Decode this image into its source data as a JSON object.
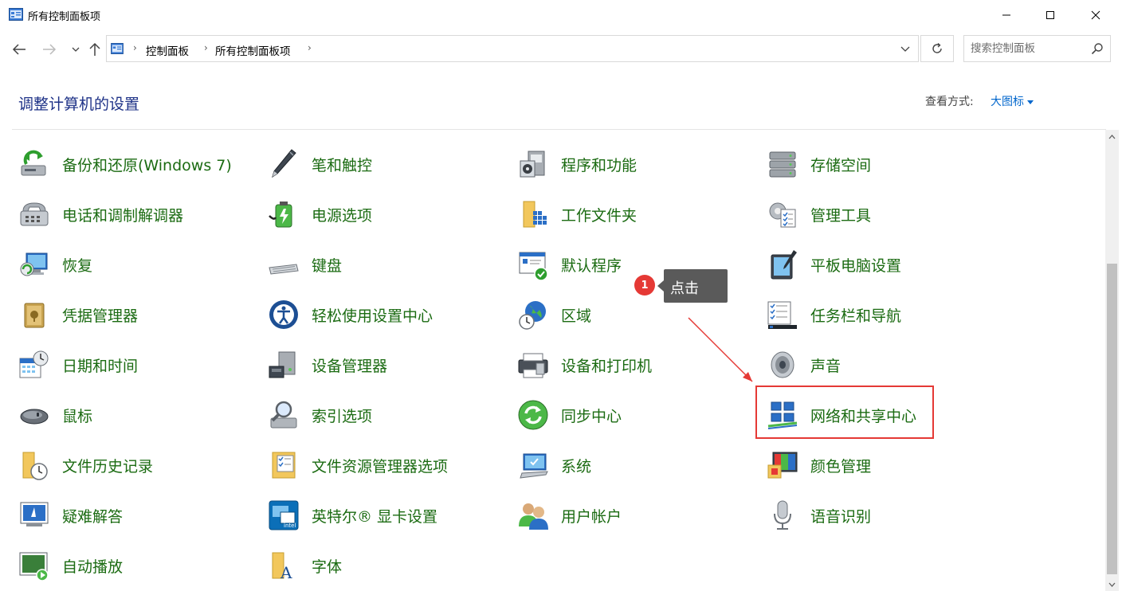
{
  "window": {
    "title": "所有控制面板项",
    "icon": "control-panel-icon"
  },
  "nav": {
    "back": "back-arrow-icon",
    "forward": "forward-arrow-icon",
    "recent": "chevron-down-icon",
    "up": "up-arrow-icon"
  },
  "address": {
    "crumbs": [
      "控制面板",
      "所有控制面板项"
    ],
    "separator": "›"
  },
  "search": {
    "placeholder": "搜索控制面板"
  },
  "header": {
    "title": "调整计算机的设置",
    "view_label": "查看方式:",
    "view_value": "大图标"
  },
  "items": [
    {
      "label": "备份和还原(Windows 7)",
      "icon": "backup-restore-icon"
    },
    {
      "label": "笔和触控",
      "icon": "pen-icon"
    },
    {
      "label": "程序和功能",
      "icon": "programs-icon"
    },
    {
      "label": "存储空间",
      "icon": "storage-icon"
    },
    {
      "label": "电话和调制解调器",
      "icon": "phone-modem-icon"
    },
    {
      "label": "电源选项",
      "icon": "power-icon"
    },
    {
      "label": "工作文件夹",
      "icon": "work-folders-icon"
    },
    {
      "label": "管理工具",
      "icon": "admin-tools-icon"
    },
    {
      "label": "恢复",
      "icon": "recovery-icon"
    },
    {
      "label": "键盘",
      "icon": "keyboard-icon"
    },
    {
      "label": "默认程序",
      "icon": "default-programs-icon"
    },
    {
      "label": "平板电脑设置",
      "icon": "tablet-icon"
    },
    {
      "label": "凭据管理器",
      "icon": "credential-icon"
    },
    {
      "label": "轻松使用设置中心",
      "icon": "ease-of-access-icon"
    },
    {
      "label": "区域",
      "icon": "region-icon"
    },
    {
      "label": "任务栏和导航",
      "icon": "taskbar-icon"
    },
    {
      "label": "日期和时间",
      "icon": "datetime-icon"
    },
    {
      "label": "设备管理器",
      "icon": "device-manager-icon"
    },
    {
      "label": "设备和打印机",
      "icon": "printer-icon"
    },
    {
      "label": "声音",
      "icon": "sound-icon"
    },
    {
      "label": "鼠标",
      "icon": "mouse-icon"
    },
    {
      "label": "索引选项",
      "icon": "indexing-icon"
    },
    {
      "label": "同步中心",
      "icon": "sync-icon"
    },
    {
      "label": "网络和共享中心",
      "icon": "network-icon"
    },
    {
      "label": "文件历史记录",
      "icon": "file-history-icon"
    },
    {
      "label": "文件资源管理器选项",
      "icon": "folder-options-icon"
    },
    {
      "label": "系统",
      "icon": "system-icon"
    },
    {
      "label": "颜色管理",
      "icon": "color-icon"
    },
    {
      "label": "疑难解答",
      "icon": "troubleshoot-icon"
    },
    {
      "label": "英特尔® 显卡设置",
      "icon": "intel-graphics-icon"
    },
    {
      "label": "用户帐户",
      "icon": "users-icon"
    },
    {
      "label": "语音识别",
      "icon": "microphone-icon"
    },
    {
      "label": "自动播放",
      "icon": "autoplay-icon"
    },
    {
      "label": "字体",
      "icon": "fonts-icon"
    }
  ],
  "annotation": {
    "step": "1",
    "text": "点击",
    "color": "#e53935"
  },
  "colors": {
    "link_green": "#1b6b12",
    "heading_blue": "#1e3287",
    "accent_blue": "#0066cc"
  }
}
